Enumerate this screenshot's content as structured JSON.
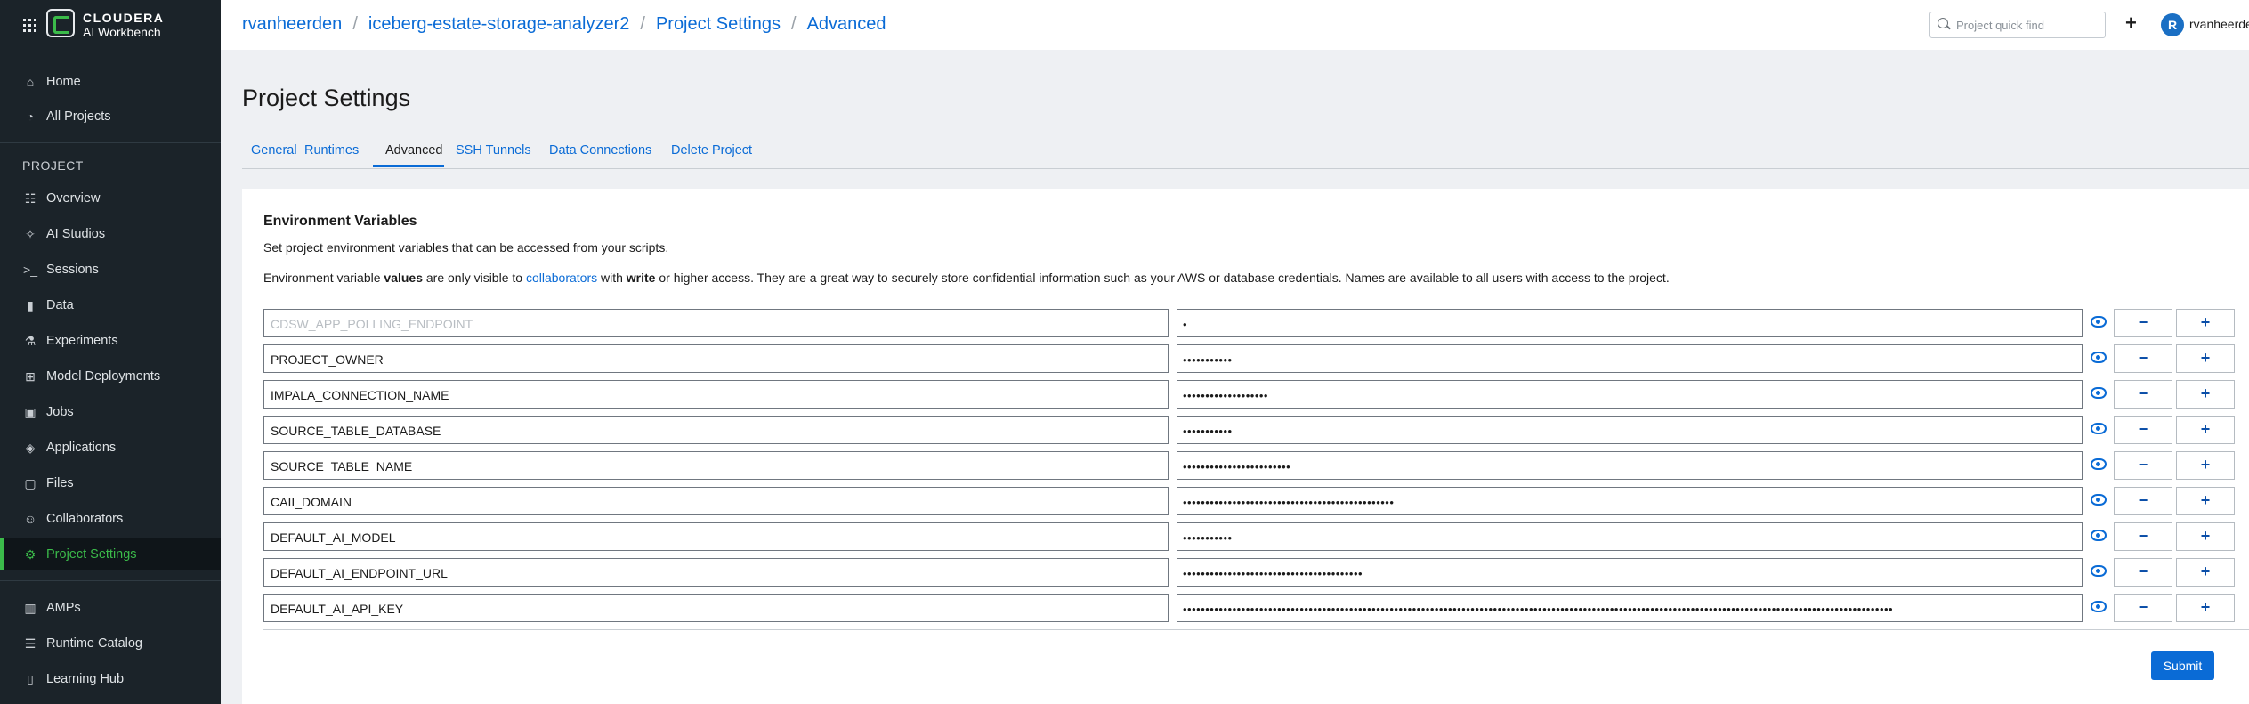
{
  "brand": {
    "line1": "CLOUDERA",
    "line2": "AI Workbench"
  },
  "sidebar": {
    "top_items": [
      {
        "label": "Home",
        "icon": "home-icon"
      },
      {
        "label": "All Projects",
        "icon": "gauge-icon"
      }
    ],
    "section_label": "PROJECT",
    "project_items": [
      {
        "label": "Overview",
        "icon": "overview-icon"
      },
      {
        "label": "AI Studios",
        "icon": "sparkle-icon"
      },
      {
        "label": "Sessions",
        "icon": "terminal-icon"
      },
      {
        "label": "Data",
        "icon": "bar-chart-icon"
      },
      {
        "label": "Experiments",
        "icon": "flask-icon"
      },
      {
        "label": "Model Deployments",
        "icon": "model-icon"
      },
      {
        "label": "Jobs",
        "icon": "briefcase-icon"
      },
      {
        "label": "Applications",
        "icon": "layers-icon"
      },
      {
        "label": "Files",
        "icon": "file-icon"
      },
      {
        "label": "Collaborators",
        "icon": "people-icon"
      },
      {
        "label": "Project Settings",
        "icon": "gear-icon",
        "active": true
      }
    ],
    "bottom_items": [
      {
        "label": "AMPs",
        "icon": "amps-icon"
      },
      {
        "label": "Runtime Catalog",
        "icon": "list-icon"
      },
      {
        "label": "Learning Hub",
        "icon": "book-icon"
      }
    ]
  },
  "breadcrumb": [
    "rvanheerden",
    "iceberg-estate-storage-analyzer2",
    "Project Settings",
    "Advanced"
  ],
  "search": {
    "placeholder": "Project quick find"
  },
  "user": {
    "initial": "R",
    "name": "rvanheerden"
  },
  "page": {
    "title": "Project Settings"
  },
  "tabs": [
    "General",
    "Runtimes",
    "Advanced",
    "SSH Tunnels",
    "Data Connections",
    "Delete Project"
  ],
  "active_tab": "Advanced",
  "env": {
    "title": "Environment Variables",
    "description": "Set project environment variables that can be accessed from your scripts.",
    "note": {
      "p1": "Environment variable ",
      "b1": "values",
      "p2": " are only visible to ",
      "link": "collaborators",
      "p3": " with ",
      "b2": "write",
      "p4": " or higher access. They are a great way to securely store confidential information such as your AWS or database credentials. Names are available to all users with access to the project."
    },
    "rows": [
      {
        "name": "",
        "placeholder": "CDSW_APP_POLLING_ENDPOINT",
        "masked": "•"
      },
      {
        "name": "PROJECT_OWNER",
        "masked": "•••••••••••"
      },
      {
        "name": "IMPALA_CONNECTION_NAME",
        "masked": "•••••••••••••••••••"
      },
      {
        "name": "SOURCE_TABLE_DATABASE",
        "masked": "•••••••••••"
      },
      {
        "name": "SOURCE_TABLE_NAME",
        "masked": "••••••••••••••••••••••••"
      },
      {
        "name": "CAII_DOMAIN",
        "masked": "•••••••••••••••••••••••••••••••••••••••••••••••"
      },
      {
        "name": "DEFAULT_AI_MODEL",
        "masked": "•••••••••••"
      },
      {
        "name": "DEFAULT_AI_ENDPOINT_URL",
        "masked": "••••••••••••••••••••••••••••••••••••••••"
      },
      {
        "name": "DEFAULT_AI_API_KEY",
        "masked": "••••••••••••••••••••••••••••••••••••••••••••••••••••••••••••••••••••••••••••••••••••••••••••••••••••••••••••••••••••••••••••••••••••••••••••••••••••••••••••••"
      }
    ],
    "minus_label": "−",
    "plus_label": "+"
  },
  "submit_label": "Submit",
  "colors": {
    "accent": "#0a6bd6",
    "brand_green": "#3bbb4a",
    "sidebar_bg": "#1b2329"
  }
}
